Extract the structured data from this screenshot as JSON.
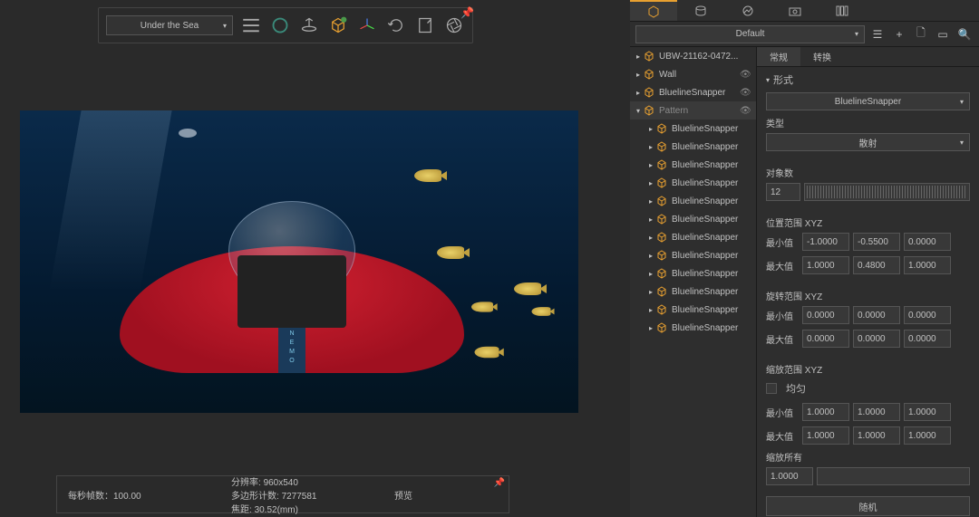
{
  "toolbar": {
    "scene_name": "Under the Sea"
  },
  "viewport": {
    "nemo_text": "N\nE\nM\nO"
  },
  "status": {
    "fps_label": "每秒帧数：",
    "fps_value": "100.00",
    "resolution_label": "分辨率: ",
    "resolution_value": "960x540",
    "polycount_label": "多边形计数: ",
    "polycount_value": "7277581",
    "focal_label": "焦距: ",
    "focal_value": "30.52(mm)",
    "preview_label": "预览"
  },
  "panel": {
    "preset_label": "Default",
    "tree": [
      {
        "label": "UBW-21162-0472...",
        "indent": 1,
        "eye": false,
        "arrow": "▸",
        "color": "#e8a030"
      },
      {
        "label": "Wall",
        "indent": 1,
        "eye": true,
        "arrow": "▸",
        "color": "#e8a030"
      },
      {
        "label": "BluelineSnapper",
        "indent": 1,
        "eye": true,
        "arrow": "▸",
        "color": "#e8a030"
      },
      {
        "label": "Pattern",
        "indent": 1,
        "eye": true,
        "arrow": "▾",
        "color": "#e8a030",
        "selected": true,
        "faded": true
      },
      {
        "label": "BluelineSnapper",
        "indent": 2,
        "eye": false,
        "arrow": "▸",
        "color": "#e8a030"
      },
      {
        "label": "BluelineSnapper",
        "indent": 2,
        "eye": false,
        "arrow": "▸",
        "color": "#e8a030"
      },
      {
        "label": "BluelineSnapper",
        "indent": 2,
        "eye": false,
        "arrow": "▸",
        "color": "#e8a030"
      },
      {
        "label": "BluelineSnapper",
        "indent": 2,
        "eye": false,
        "arrow": "▸",
        "color": "#e8a030"
      },
      {
        "label": "BluelineSnapper",
        "indent": 2,
        "eye": false,
        "arrow": "▸",
        "color": "#e8a030"
      },
      {
        "label": "BluelineSnapper",
        "indent": 2,
        "eye": false,
        "arrow": "▸",
        "color": "#e8a030"
      },
      {
        "label": "BluelineSnapper",
        "indent": 2,
        "eye": false,
        "arrow": "▸",
        "color": "#e8a030"
      },
      {
        "label": "BluelineSnapper",
        "indent": 2,
        "eye": false,
        "arrow": "▸",
        "color": "#e8a030"
      },
      {
        "label": "BluelineSnapper",
        "indent": 2,
        "eye": false,
        "arrow": "▸",
        "color": "#e8a030"
      },
      {
        "label": "BluelineSnapper",
        "indent": 2,
        "eye": false,
        "arrow": "▸",
        "color": "#e8a030"
      },
      {
        "label": "BluelineSnapper",
        "indent": 2,
        "eye": false,
        "arrow": "▸",
        "color": "#e8a030"
      },
      {
        "label": "BluelineSnapper",
        "indent": 2,
        "eye": false,
        "arrow": "▸",
        "color": "#e8a030"
      }
    ],
    "tabs": {
      "general": "常规",
      "transform": "转换"
    },
    "form_header": "形式",
    "form_value": "BluelineSnapper",
    "type_label": "类型",
    "type_value": "散射",
    "count_label": "对象数",
    "count_value": "12",
    "pos_range_label": "位置范围 XYZ",
    "min_label": "最小值",
    "max_label": "最大值",
    "pos_min": [
      "-1.0000",
      "-0.5500",
      "0.0000"
    ],
    "pos_max": [
      "1.0000",
      "0.4800",
      "1.0000"
    ],
    "rot_range_label": "旋转范围 XYZ",
    "rot_min": [
      "0.0000",
      "0.0000",
      "0.0000"
    ],
    "rot_max": [
      "0.0000",
      "0.0000",
      "0.0000"
    ],
    "scale_range_label": "缩放范围 XYZ",
    "uniform_label": "均匀",
    "scale_min": [
      "1.0000",
      "1.0000",
      "1.0000"
    ],
    "scale_max": [
      "1.0000",
      "1.0000",
      "1.0000"
    ],
    "scale_all_label": "缩放所有",
    "scale_all_value": "1.0000",
    "random_button": "随机"
  }
}
